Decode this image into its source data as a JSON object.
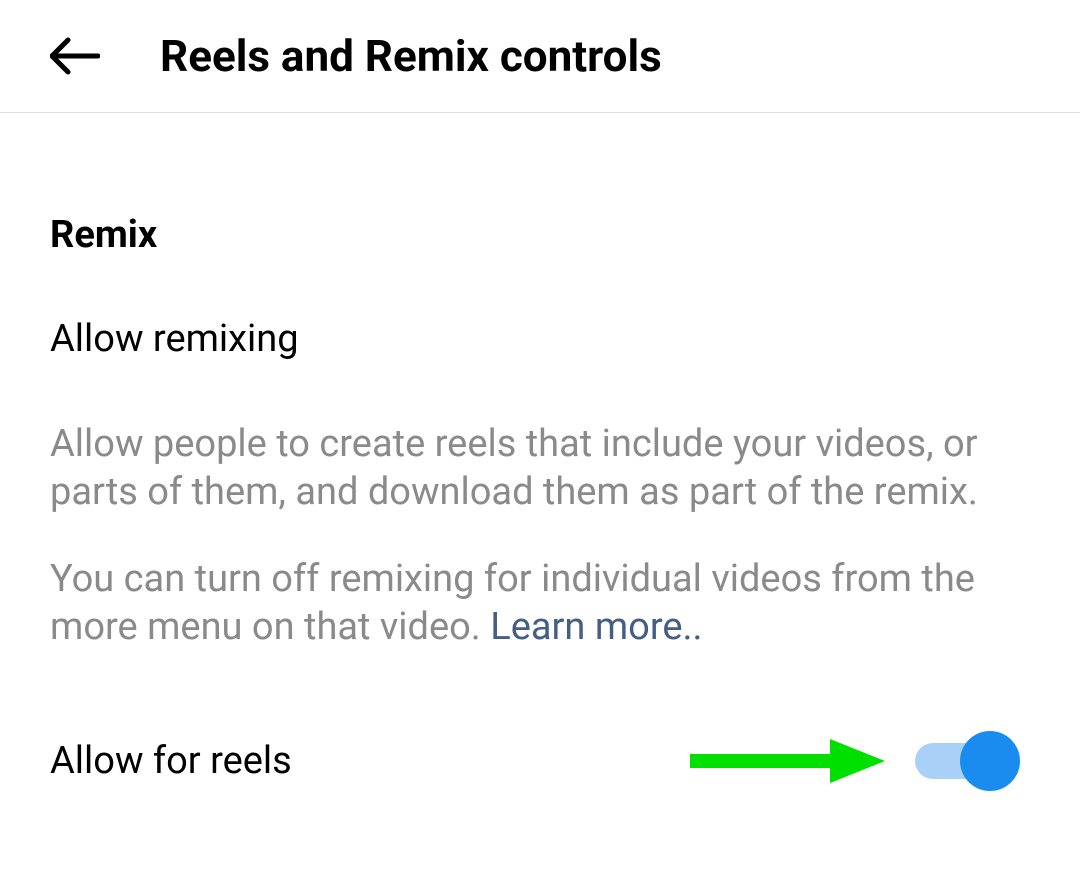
{
  "header": {
    "title": "Reels and Remix controls"
  },
  "section": {
    "title": "Remix",
    "subtitle": "Allow remixing",
    "description1": "Allow people to create reels that include your videos, or parts of them, and download them as part of the remix.",
    "description2_prefix": "You can turn off remixing for individual videos from the more menu on that video. ",
    "learn_more": "Learn more.."
  },
  "toggle": {
    "label": "Allow for reels",
    "state": "on"
  },
  "colors": {
    "toggle_thumb": "#1a8cf0",
    "toggle_track": "#a9d1f7",
    "arrow_annotation": "#00e000",
    "text_muted": "#8a8a8a",
    "link": "#445e85"
  }
}
